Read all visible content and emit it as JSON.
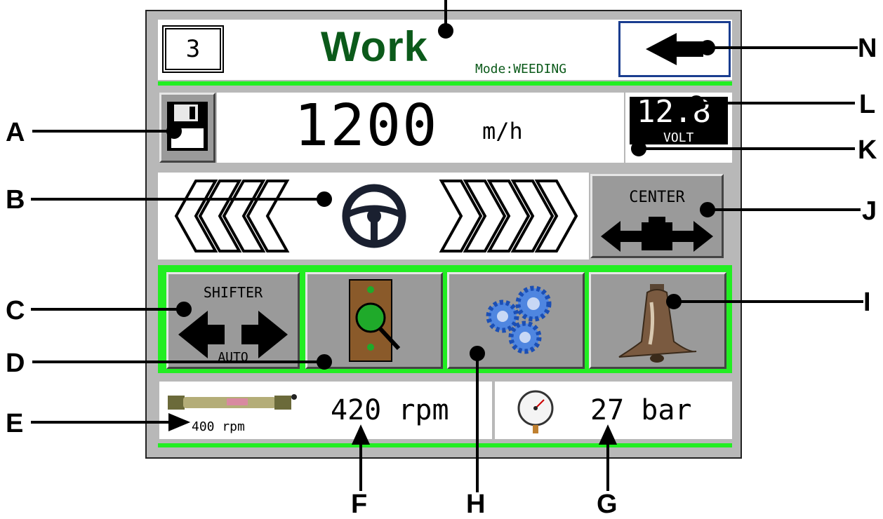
{
  "header": {
    "page_number": "3",
    "title": "Work",
    "mode_label": "Mode:",
    "mode_value": "WEEDING",
    "back_icon": "left-triangle-icon"
  },
  "speed": {
    "value": "1200",
    "unit": "m/h",
    "save_icon": "floppy-disk-icon"
  },
  "voltage": {
    "value": "12.8",
    "unit": "VOLT"
  },
  "steering": {
    "center_label": "CENTER",
    "left_icon": "chevrons-left-icon",
    "wheel_icon": "steering-wheel-icon",
    "right_icon": "chevrons-right-icon"
  },
  "buttons": {
    "shifter_label": "SHIFTER",
    "shifter_mode": "AUTO",
    "inspect_icon": "magnifier-sensor-icon",
    "gears_icon": "gears-icon",
    "bell_icon": "bell-icon"
  },
  "status": {
    "pto_setpoint": "400 rpm",
    "pto_speed": "420 rpm",
    "pressure": "27 bar",
    "pto_icon": "pto-shaft-icon",
    "gauge_icon": "pressure-gauge-icon"
  },
  "callouts": [
    "A",
    "B",
    "C",
    "D",
    "E",
    "F",
    "G",
    "H",
    "I",
    "J",
    "K",
    "L",
    "N"
  ],
  "colors": {
    "title_green": "#0b5a1a",
    "accent_green": "#22ee22",
    "button_gray": "#9a9a9a",
    "back_border": "#1a3d8f"
  }
}
